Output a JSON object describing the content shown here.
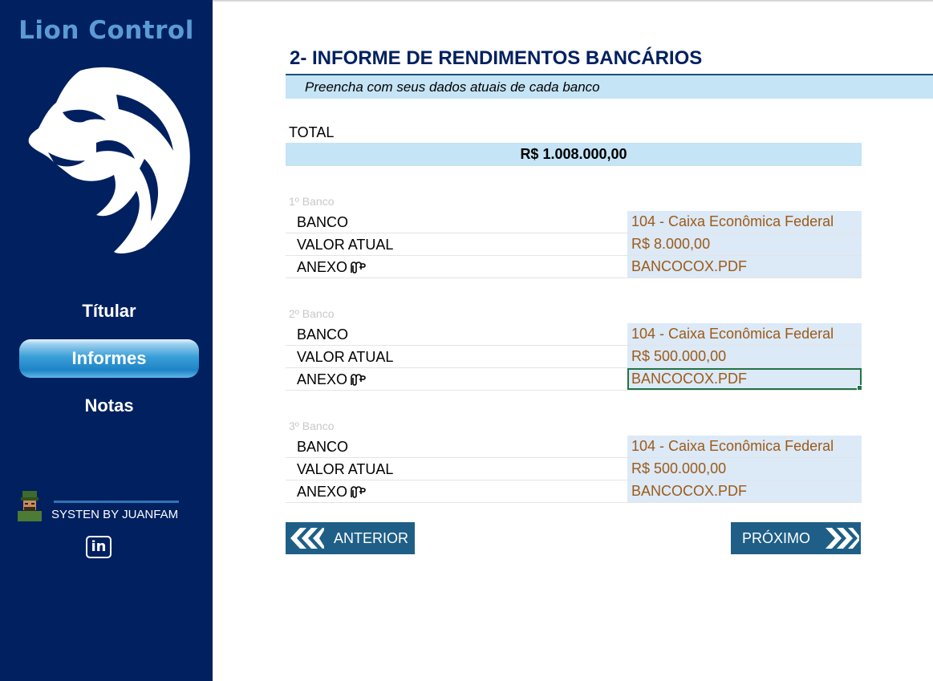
{
  "sidebar": {
    "brand": "Lion Control",
    "nav": [
      {
        "label": "Títular",
        "active": false
      },
      {
        "label": "Informes",
        "active": true
      },
      {
        "label": "Notas",
        "active": false
      }
    ],
    "credit": "SYSTEN BY JUANFAM",
    "linkedin_icon": "in"
  },
  "main": {
    "title": "2- INFORME DE RENDIMENTOS BANCÁRIOS",
    "subtitle": "Preencha  com seus dados atuais de cada banco",
    "total_label": "TOTAL",
    "total_value": "R$ 1.008.000,00",
    "banks": [
      {
        "caption": "1º Banco",
        "rows": [
          {
            "label": "BANCO",
            "value": "104 - Caixa Econômica Federal"
          },
          {
            "label": "VALOR ATUAL",
            "value": "R$ 8.000,00"
          },
          {
            "label": "ANEXO",
            "value": "BANCOCOX.PDF"
          }
        ]
      },
      {
        "caption": "2º Banco",
        "rows": [
          {
            "label": "BANCO",
            "value": "104 - Caixa Econômica Federal"
          },
          {
            "label": "VALOR ATUAL",
            "value": "R$ 500.000,00"
          },
          {
            "label": "ANEXO",
            "value": "BANCOCOX.PDF"
          }
        ]
      },
      {
        "caption": "3º Banco",
        "rows": [
          {
            "label": "BANCO",
            "value": "104 - Caixa Econômica Federal"
          },
          {
            "label": "VALOR ATUAL",
            "value": "R$ 500.000,00"
          },
          {
            "label": "ANEXO",
            "value": "BANCOCOX.PDF"
          }
        ]
      }
    ],
    "prev_label": "ANTERIOR",
    "next_label": "PRÓXIMO"
  },
  "colors": {
    "sidebar_bg": "#002060",
    "brand": "#5b9bd5",
    "accent_light": "#c5e4f5",
    "value_text": "#9c5a16",
    "button_bg": "#1f5f87"
  },
  "icons": [
    "lion-logo-icon",
    "avatar-icon",
    "linkedin-icon",
    "paperclip-icon",
    "chevron-left-icon",
    "chevron-right-icon"
  ]
}
